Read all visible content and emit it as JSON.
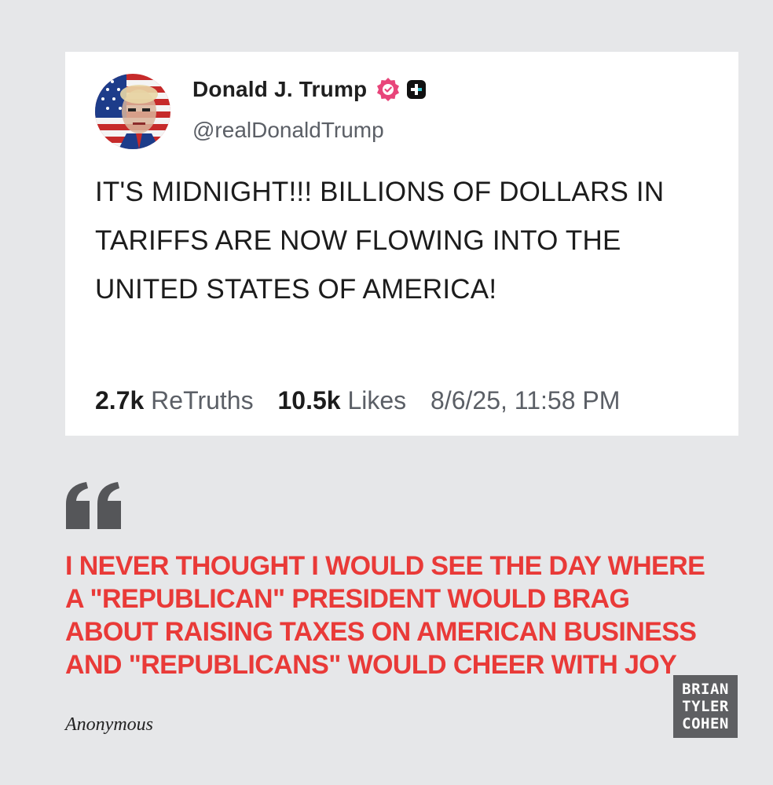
{
  "post": {
    "author_name": "Donald J. Trump",
    "handle": "@realDonaldTrump",
    "avatar_icon": "flag-portrait-avatar",
    "verified_icon": "verified-badge-icon",
    "verified_color": "#e8457a",
    "plus_icon": "plus-badge-icon",
    "text": "IT'S MIDNIGHT!!! BILLIONS OF DOLLARS IN TARIFFS ARE NOW FLOWING INTO THE UNITED STATES OF AMERICA!",
    "retruths_count": "2.7k",
    "retruths_label": "ReTruths",
    "likes_count": "10.5k",
    "likes_label": "Likes",
    "timestamp": "8/6/25, 11:58 PM"
  },
  "quote": {
    "icon": "quote-mark-icon",
    "text": "I NEVER THOUGHT I WOULD SEE THE DAY WHERE A \"REPUBLICAN\" PRESIDENT WOULD BRAG ABOUT RAISING TAXES ON AMERICAN BUSINESS AND \"REPUBLICANS\" WOULD CHEER WITH JOY",
    "attribution": "Anonymous",
    "color": "#e93a38"
  },
  "watermark": {
    "line1": "BRIAN",
    "line2": "TYLER",
    "line3": "COHEN"
  }
}
